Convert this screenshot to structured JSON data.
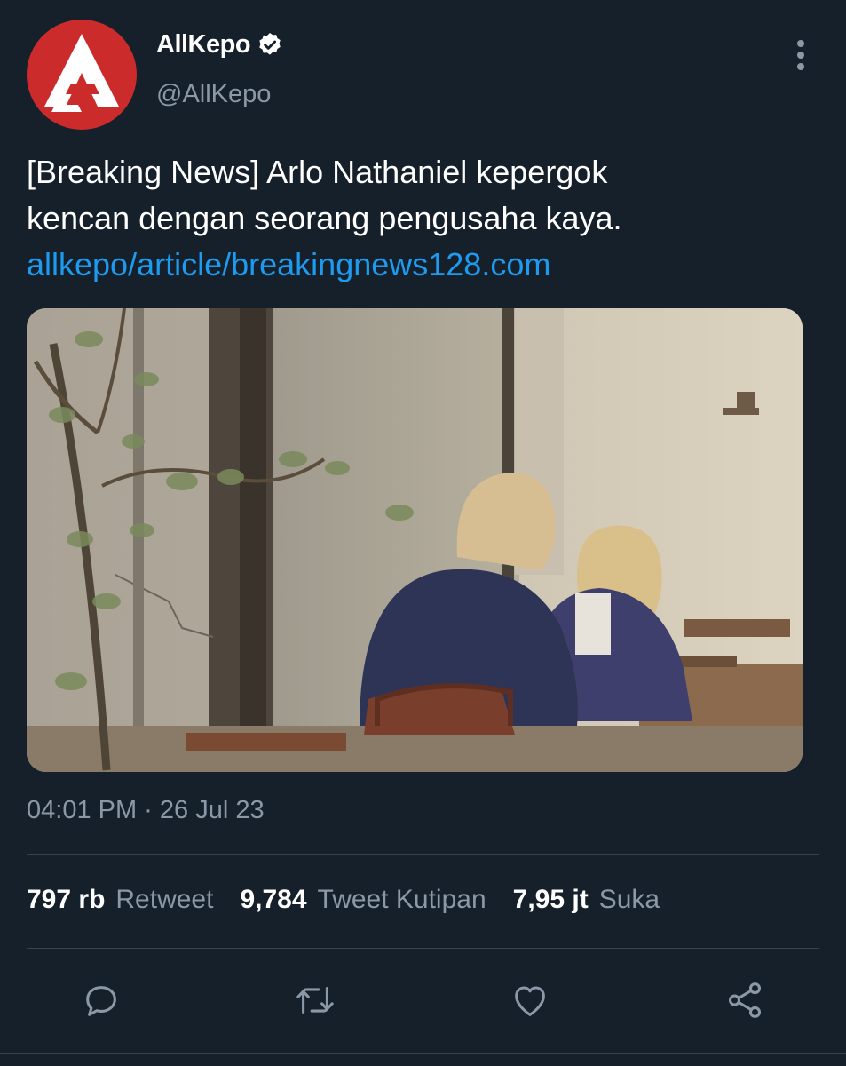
{
  "tweet": {
    "account": {
      "name": "AllKepo",
      "handle": "@AllKepo",
      "verified": true,
      "avatar_icon": "allkepo-logo-icon",
      "avatar_color": "#cc2b2b"
    },
    "text_lines": [
      "[Breaking News] Arlo Nathaniel kepergok",
      "kencan dengan seorang pengusaha kaya."
    ],
    "link": "allkepo/article/breakingnews128.com",
    "timestamp": "04:01 PM · 26 Jul 23",
    "stats": {
      "retweets_count": "797 rb",
      "retweets_label": "Retweet",
      "quotes_count": "9,784",
      "quotes_label": "Tweet Kutipan",
      "likes_count": "7,95 jt",
      "likes_label": "Suka"
    },
    "actions": [
      "reply-icon",
      "retweet-icon",
      "like-icon",
      "share-icon"
    ]
  },
  "colors": {
    "background": "#15202b",
    "link": "#1d9bf0",
    "secondary_text": "#8b98a5",
    "divider": "#38444d"
  }
}
